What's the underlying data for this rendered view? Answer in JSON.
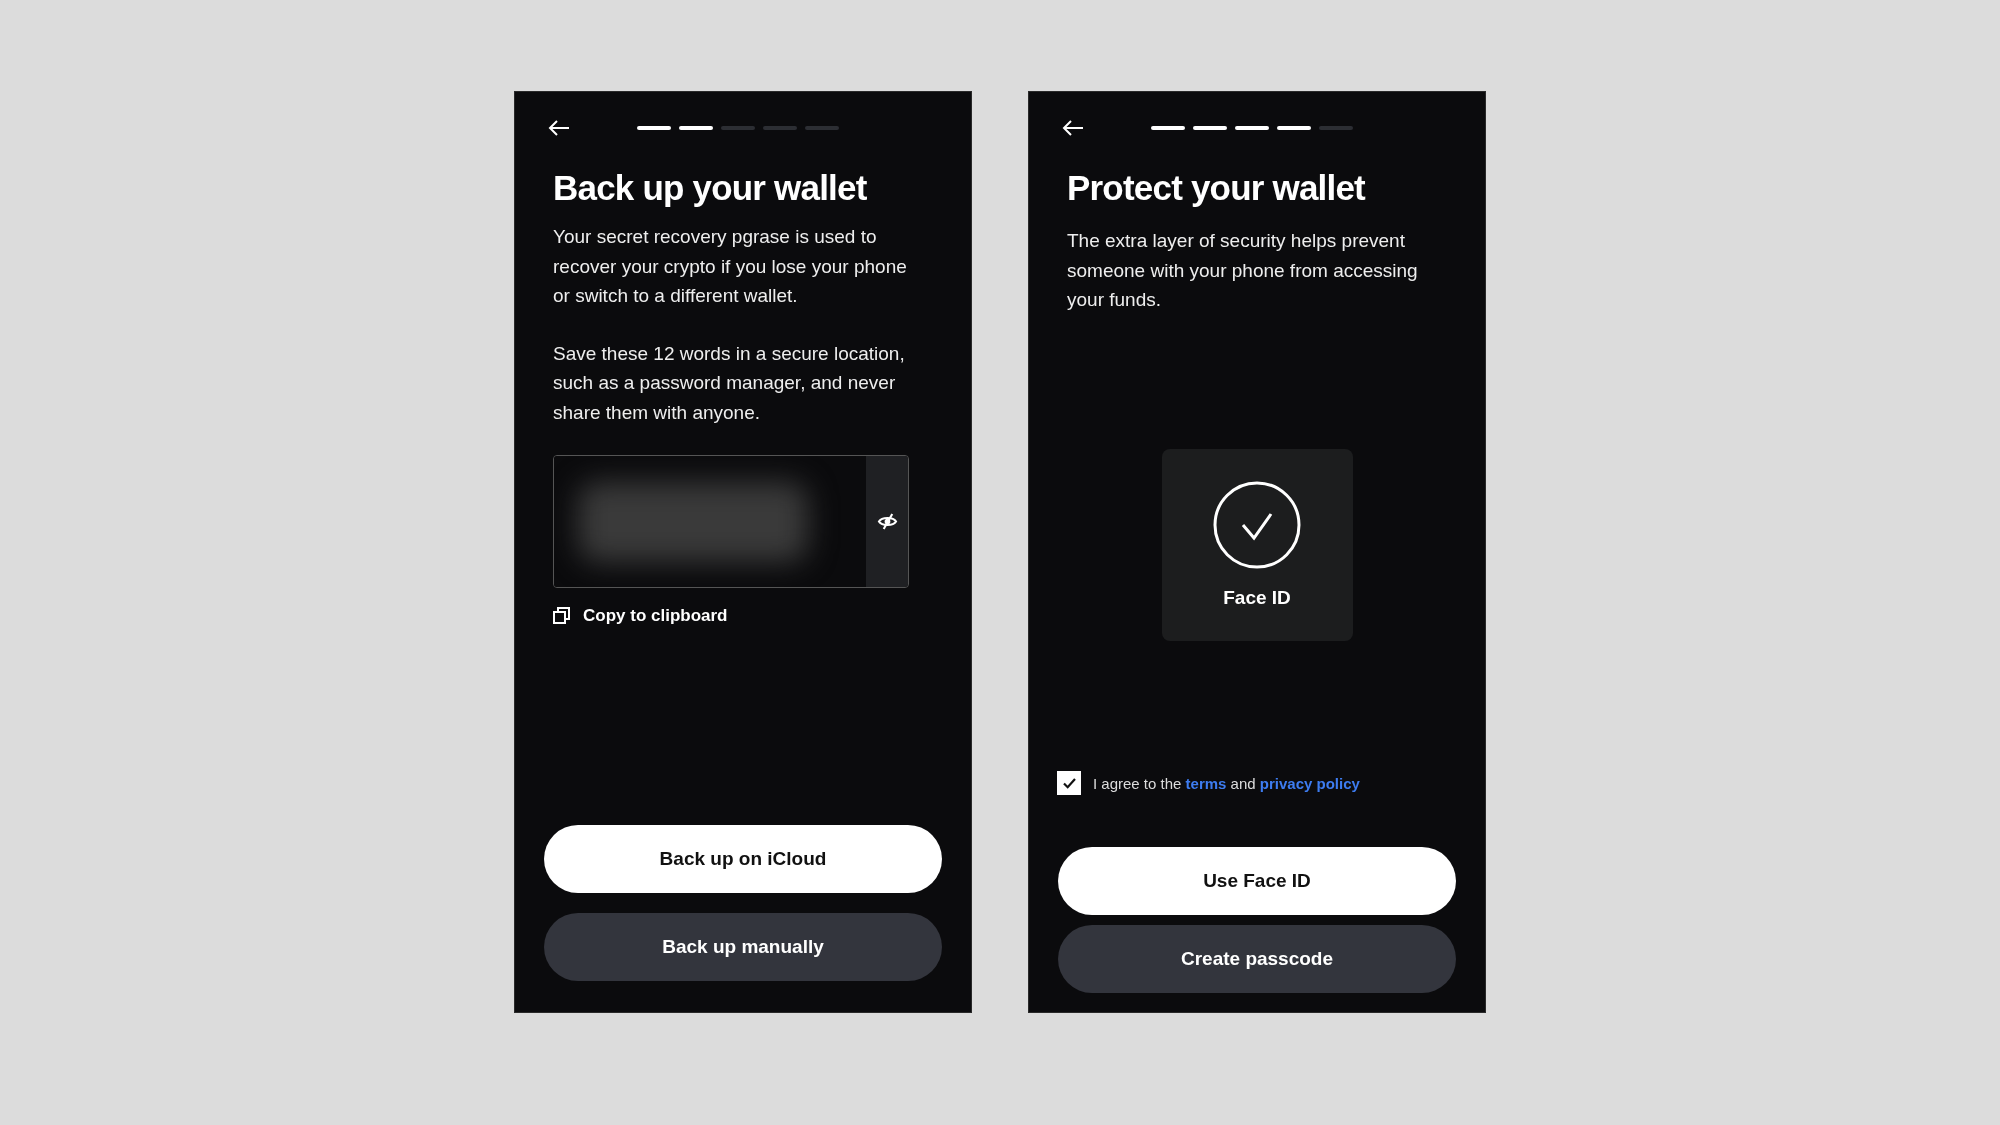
{
  "backup_screen": {
    "progress": [
      {
        "done": true
      },
      {
        "done": true
      },
      {
        "done": false
      },
      {
        "done": false
      },
      {
        "done": false
      }
    ],
    "title": "Back up your wallet",
    "paragraphs": [
      "Your secret recovery pgrase is used to recover your crypto if you lose your phone or switch to a different wallet.",
      "Save these 12 words in a secure location, such as a password manager, and never share them with anyone."
    ],
    "phrase": {
      "hidden": true
    },
    "copy_link": "Copy to clipboard",
    "buttons": [
      {
        "label": "Back up on iCloud",
        "kind": "primary"
      },
      {
        "label": "Back up manually",
        "kind": "secondary"
      }
    ]
  },
  "protect_screen": {
    "progress": [
      {
        "done": true
      },
      {
        "done": true
      },
      {
        "done": true
      },
      {
        "done": true
      },
      {
        "done": false
      }
    ],
    "title": "Protect your wallet",
    "paragraph": "The extra layer of security helps prevent someone with your phone from accessing your funds.",
    "option": {
      "label": "Face ID"
    },
    "agreement": {
      "checked": true,
      "before": "I agree to the",
      "link_1": "terms",
      "middle": "and",
      "link_2": "privacy policy"
    },
    "buttons": [
      {
        "label": "Use Face ID",
        "kind": "primary"
      },
      {
        "label": "Create passcode",
        "kind": "secondary"
      }
    ]
  }
}
